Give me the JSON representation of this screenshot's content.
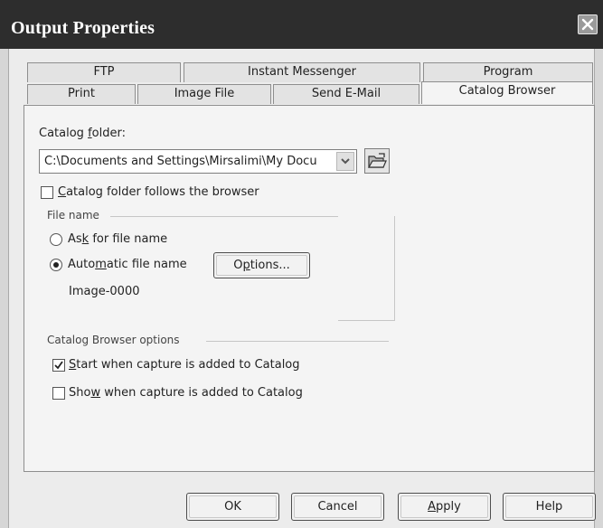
{
  "window": {
    "title": "Output Properties",
    "close_icon": "close-icon"
  },
  "tabs": {
    "row_back": [
      {
        "label": "FTP"
      },
      {
        "label": "Instant Messenger"
      },
      {
        "label": "Program"
      }
    ],
    "row_front": [
      {
        "label": "Print"
      },
      {
        "label": "Image File"
      },
      {
        "label": "Send E-Mail"
      },
      {
        "label": "Catalog Browser",
        "active": true
      }
    ]
  },
  "catalog": {
    "folder_label_pre": "Catalog ",
    "folder_label_mnemonic": "f",
    "folder_label_post": "older:",
    "folder_value": "C:\\Documents and Settings\\Mirsalimi\\My Docu",
    "browse_icon": "open-folder-icon",
    "follows_browser": {
      "mnemonic": "C",
      "label_rest": "atalog folder follows the browser",
      "checked": false
    }
  },
  "file_name": {
    "group_title": "File name",
    "ask": {
      "pre": "As",
      "mnemonic": "k",
      "post": " for file name",
      "selected": false
    },
    "automatic": {
      "pre": "Auto",
      "mnemonic": "m",
      "post": "atic file name",
      "selected": true
    },
    "options_button": {
      "pre": "O",
      "mnemonic": "p",
      "post": "tions..."
    },
    "preview_name": "Image-0000"
  },
  "browser_options": {
    "group_title": "Catalog Browser options",
    "start": {
      "mnemonic": "S",
      "label_rest": "tart when capture is added to Catalog",
      "checked": true
    },
    "show": {
      "pre": "Sho",
      "mnemonic": "w",
      "post": " when capture is added to Catalog",
      "checked": false
    }
  },
  "buttons": {
    "ok": "OK",
    "cancel": "Cancel",
    "apply_mnemonic": "A",
    "apply_rest": "pply",
    "help": "Help"
  }
}
